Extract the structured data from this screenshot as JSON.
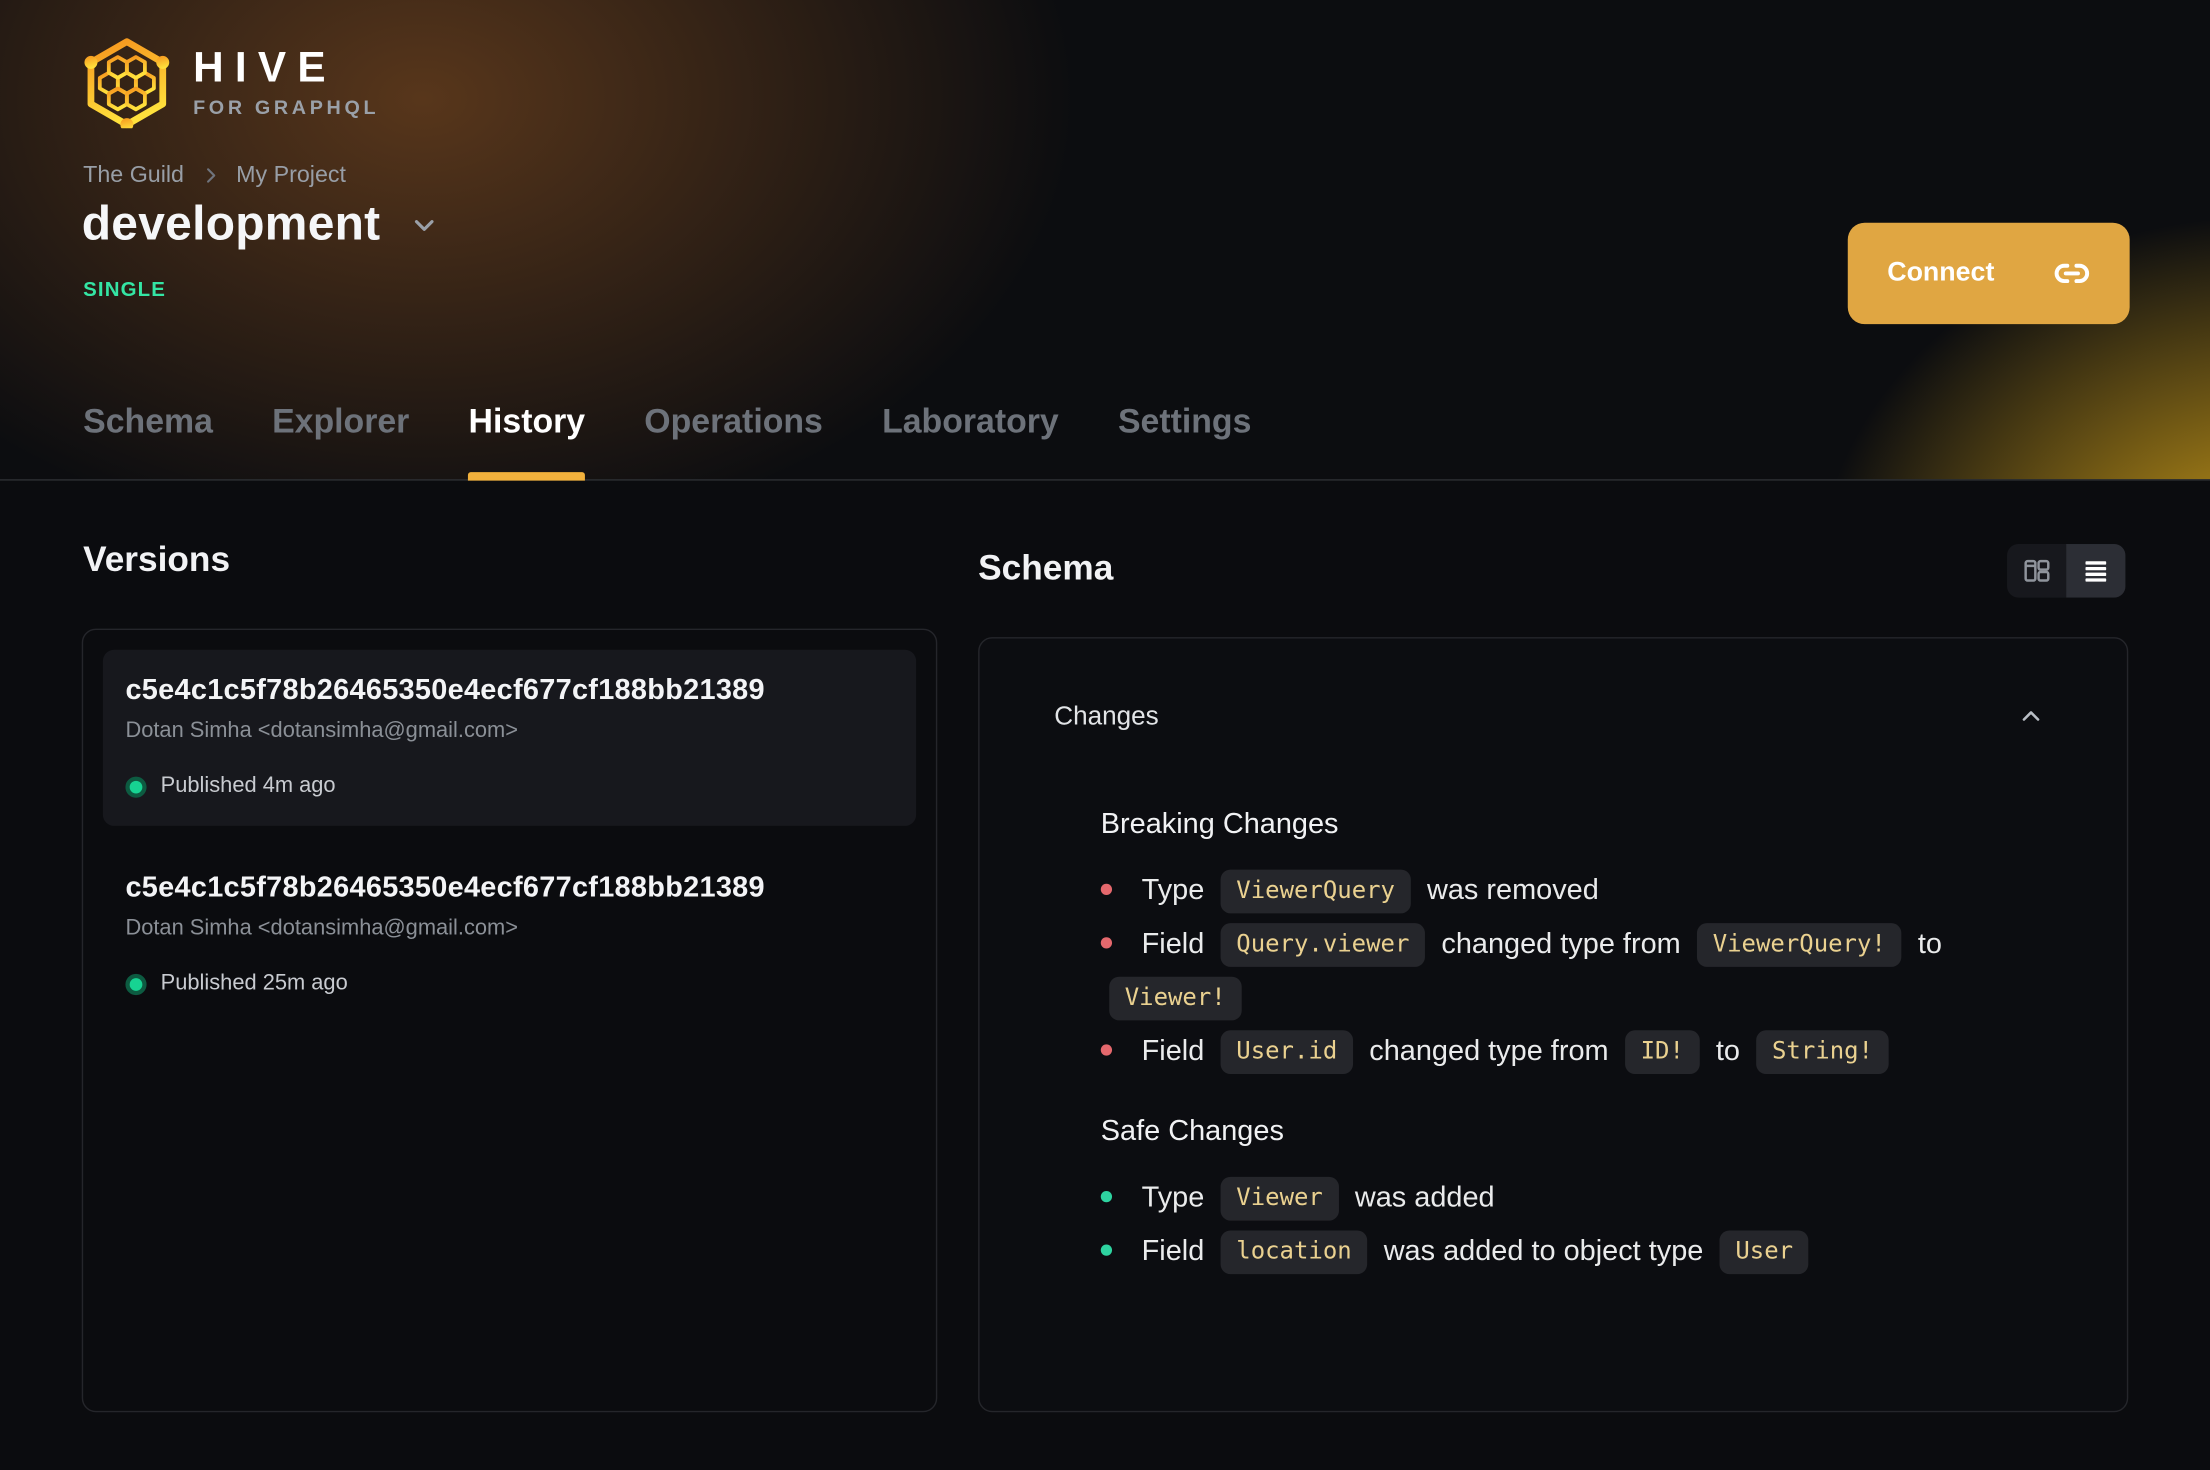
{
  "brand": {
    "name": "HIVE",
    "tagline": "FOR GRAPHQL"
  },
  "breadcrumb": {
    "organization": "The Guild",
    "project": "My Project"
  },
  "target": {
    "name": "development",
    "badge": "SINGLE"
  },
  "connect": {
    "label": "Connect"
  },
  "tabs": [
    {
      "label": "Schema",
      "active": false
    },
    {
      "label": "Explorer",
      "active": false
    },
    {
      "label": "History",
      "active": true
    },
    {
      "label": "Operations",
      "active": false
    },
    {
      "label": "Laboratory",
      "active": false
    },
    {
      "label": "Settings",
      "active": false
    }
  ],
  "versions": {
    "title": "Versions",
    "items": [
      {
        "hash": "c5e4c1c5f78b26465350e4ecf677cf188bb21389",
        "author": "Dotan Simha <dotansimha@gmail.com>",
        "status": "Published 4m ago",
        "selected": true
      },
      {
        "hash": "c5e4c1c5f78b26465350e4ecf677cf188bb21389",
        "author": "Dotan Simha <dotansimha@gmail.com>",
        "status": "Published 25m ago",
        "selected": false
      }
    ]
  },
  "schema_panel": {
    "title": "Schema",
    "view_toggle": [
      {
        "name": "split-view",
        "icon": "split-view-icon",
        "active": false
      },
      {
        "name": "unified-view",
        "icon": "unified-view-icon",
        "active": true
      }
    ],
    "changes": {
      "header": "Changes",
      "collapsed": false,
      "sections": [
        {
          "title": "Breaking Changes",
          "kind": "breaking",
          "items": [
            [
              {
                "t": "text",
                "v": "Type"
              },
              {
                "t": "code",
                "v": "ViewerQuery"
              },
              {
                "t": "text",
                "v": "was removed"
              }
            ],
            [
              {
                "t": "text",
                "v": "Field"
              },
              {
                "t": "code",
                "v": "Query.viewer"
              },
              {
                "t": "text",
                "v": "changed type from"
              },
              {
                "t": "code",
                "v": "ViewerQuery!"
              },
              {
                "t": "text",
                "v": "to"
              },
              {
                "t": "code",
                "v": "Viewer!"
              }
            ],
            [
              {
                "t": "text",
                "v": "Field"
              },
              {
                "t": "code",
                "v": "User.id"
              },
              {
                "t": "text",
                "v": "changed type from"
              },
              {
                "t": "code",
                "v": "ID!"
              },
              {
                "t": "text",
                "v": "to"
              },
              {
                "t": "code",
                "v": "String!"
              }
            ]
          ]
        },
        {
          "title": "Safe Changes",
          "kind": "safe",
          "items": [
            [
              {
                "t": "text",
                "v": "Type"
              },
              {
                "t": "code",
                "v": "Viewer"
              },
              {
                "t": "text",
                "v": "was added"
              }
            ],
            [
              {
                "t": "text",
                "v": "Field"
              },
              {
                "t": "code",
                "v": "location"
              },
              {
                "t": "text",
                "v": "was added to object type"
              },
              {
                "t": "code",
                "v": "User"
              }
            ]
          ]
        }
      ]
    }
  },
  "icons": {
    "logo": "hive-logo",
    "breadcrumb_separator": "chevron-right-icon",
    "target_expander": "chevron-down-icon",
    "connect": "link-icon",
    "changes_collapse": "chevron-up-icon",
    "version_status": "status-dot-icon",
    "view_split": "split-view-icon",
    "view_unified": "unified-view-icon"
  },
  "colors": {
    "accent-yellow": "#f2b13c",
    "connect-bg": "#e0a642",
    "badge-green": "#34e5a4",
    "breaking-bullet": "#e5686d",
    "safe-bullet": "#2ed3a0",
    "code-text": "#ead190",
    "status-dot": "#17d392",
    "status-dot-ring": "#0d5b41"
  }
}
